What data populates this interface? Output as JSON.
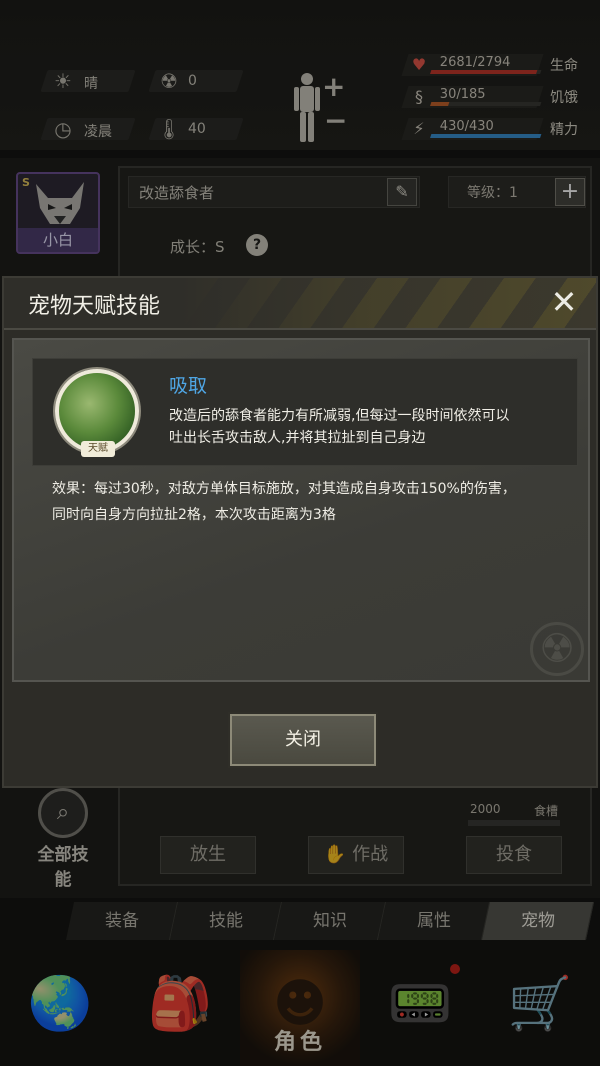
{
  "status": {
    "weather": "晴",
    "radiation": "0",
    "time": "凌晨",
    "temperature": "40"
  },
  "vitals": [
    {
      "value": "2681/2794",
      "label": "生命",
      "color": "#c0382c",
      "fill": 0.96,
      "icon": "heart-monitor-icon"
    },
    {
      "value": "30/185",
      "label": "饥饿",
      "color": "#c0622c",
      "fill": 0.16,
      "icon": "stomach-icon"
    },
    {
      "value": "430/430",
      "label": "精力",
      "color": "#3a8fd0",
      "fill": 1.0,
      "icon": "energy-icon"
    }
  ],
  "pet": {
    "name": "小白",
    "badge": "S",
    "name_field": "改造舔食者",
    "level": "等级：1",
    "growth": "成长：S",
    "all_skills": "全部技能",
    "food_value": "2000",
    "food_label": "食槽",
    "release": "放生",
    "battle": "作战",
    "feed": "投食"
  },
  "tabs": [
    "装备",
    "技能",
    "知识",
    "属性",
    "宠物"
  ],
  "active_tab": "宠物",
  "bottom_nav": [
    {
      "name": "world-map",
      "icon": "globe-icon",
      "label": ""
    },
    {
      "name": "backpack",
      "icon": "backpack-icon",
      "label": ""
    },
    {
      "name": "character",
      "icon": "character-head-icon",
      "label": "角色"
    },
    {
      "name": "radio",
      "icon": "walkie-talkie-icon",
      "label": ""
    },
    {
      "name": "shop",
      "icon": "shopping-cart-icon",
      "label": ""
    }
  ],
  "modal": {
    "title": "宠物天赋技能",
    "skill_name": "吸取",
    "skill_tag": "天赋",
    "skill_desc_line1": "改造后的舔食者能力有所减弱,但每过一段时间依然可以",
    "skill_desc_line2": "吐出长舌攻击敌人,并将其拉扯到自己身边",
    "effect_line1": "效果：每过30秒，对敌方单体目标施放，对其造成自身攻击150%的伤害，",
    "effect_line2": "同时向自身方向拉扯2格，本次攻击距离为3格",
    "close_label": "关闭"
  }
}
